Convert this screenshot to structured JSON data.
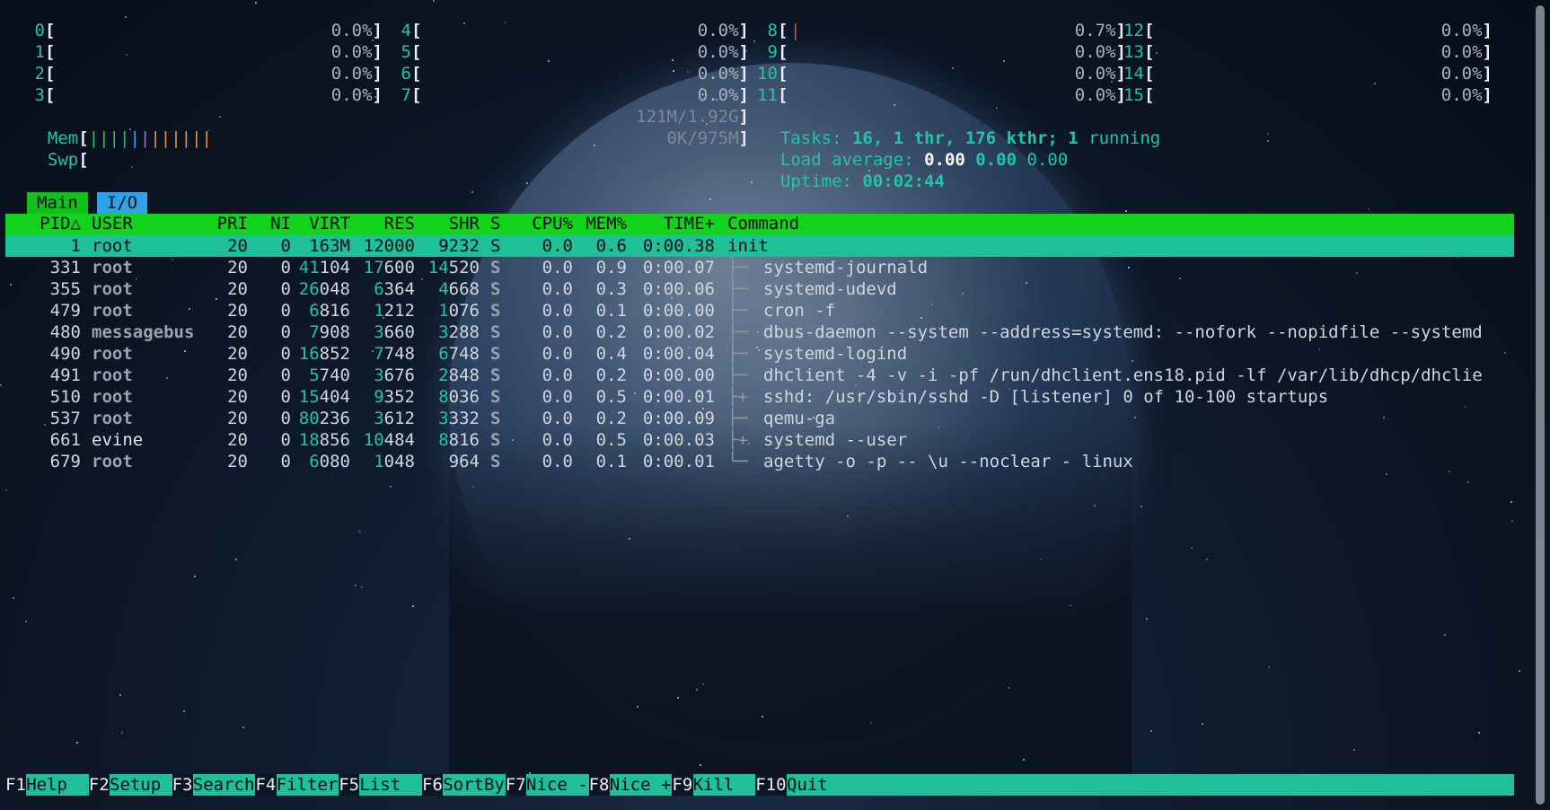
{
  "cpus": [
    {
      "id": "0",
      "value": "0.0%"
    },
    {
      "id": "1",
      "value": "0.0%"
    },
    {
      "id": "2",
      "value": "0.0%"
    },
    {
      "id": "3",
      "value": "0.0%"
    },
    {
      "id": "4",
      "value": "0.0%"
    },
    {
      "id": "5",
      "value": "0.0%"
    },
    {
      "id": "6",
      "value": "0.0%"
    },
    {
      "id": "7",
      "value": "0.0%"
    },
    {
      "id": "8",
      "value": "0.7%"
    },
    {
      "id": "9",
      "value": "0.0%"
    },
    {
      "id": "10",
      "value": "0.0%"
    },
    {
      "id": "11",
      "value": "0.0%"
    },
    {
      "id": "12",
      "value": "0.0%"
    },
    {
      "id": "13",
      "value": "0.0%"
    },
    {
      "id": "14",
      "value": "0.0%"
    },
    {
      "id": "15",
      "value": "0.0%"
    }
  ],
  "mem": {
    "label": "Mem",
    "value": "121M/1.92G"
  },
  "swp": {
    "label": "Swp",
    "value": "0K/975M"
  },
  "tasks": {
    "label": "Tasks:",
    "count": "16,",
    "thr": "1 thr,",
    "kthr": "176 kthr;",
    "running_count": "1",
    "running": "running"
  },
  "load": {
    "label": "Load average:",
    "l1": "0.00",
    "l5": "0.00",
    "l15": "0.00"
  },
  "uptime": {
    "label": "Uptime:",
    "value": "00:02:44"
  },
  "tabs": {
    "main": "Main",
    "io": "I/O"
  },
  "headers": {
    "pid": "PID",
    "sort": "△",
    "user": "USER",
    "pri": "PRI",
    "ni": "NI",
    "virt": "VIRT",
    "res": "RES",
    "shr": "SHR",
    "s": "S",
    "cpu": "CPU%",
    "mem": "MEM%",
    "time": "TIME+",
    "command": "Command"
  },
  "processes": [
    {
      "pid": "1",
      "user": "root",
      "pri": "20",
      "ni": "0",
      "virt": "163M",
      "res": "12000",
      "shr": "9232",
      "s": "S",
      "cpu": "0.0",
      "mem": "0.6",
      "time": "0:00.38",
      "tree": "",
      "command": "init"
    },
    {
      "pid": "331",
      "user": "root",
      "pri": "20",
      "ni": "0",
      "virt": "41104",
      "res": "17600",
      "shr": "14520",
      "s": "S",
      "cpu": "0.0",
      "mem": "0.9",
      "time": "0:00.07",
      "tree": "├─",
      "command": "systemd-journald"
    },
    {
      "pid": "355",
      "user": "root",
      "pri": "20",
      "ni": "0",
      "virt": "26048",
      "res": "6364",
      "shr": "4668",
      "s": "S",
      "cpu": "0.0",
      "mem": "0.3",
      "time": "0:00.06",
      "tree": "├─",
      "command": "systemd-udevd"
    },
    {
      "pid": "479",
      "user": "root",
      "pri": "20",
      "ni": "0",
      "virt": "6816",
      "res": "1212",
      "shr": "1076",
      "s": "S",
      "cpu": "0.0",
      "mem": "0.1",
      "time": "0:00.00",
      "tree": "├─",
      "command": "cron -f"
    },
    {
      "pid": "480",
      "user": "messagebus",
      "pri": "20",
      "ni": "0",
      "virt": "7908",
      "res": "3660",
      "shr": "3288",
      "s": "S",
      "cpu": "0.0",
      "mem": "0.2",
      "time": "0:00.02",
      "tree": "├─",
      "command": "dbus-daemon --system --address=systemd: --nofork --nopidfile --systemd"
    },
    {
      "pid": "490",
      "user": "root",
      "pri": "20",
      "ni": "0",
      "virt": "16852",
      "res": "7748",
      "shr": "6748",
      "s": "S",
      "cpu": "0.0",
      "mem": "0.4",
      "time": "0:00.04",
      "tree": "├─",
      "command": "systemd-logind"
    },
    {
      "pid": "491",
      "user": "root",
      "pri": "20",
      "ni": "0",
      "virt": "5740",
      "res": "3676",
      "shr": "2848",
      "s": "S",
      "cpu": "0.0",
      "mem": "0.2",
      "time": "0:00.00",
      "tree": "├─",
      "command": "dhclient -4 -v -i -pf /run/dhclient.ens18.pid -lf /var/lib/dhcp/dhclie"
    },
    {
      "pid": "510",
      "user": "root",
      "pri": "20",
      "ni": "0",
      "virt": "15404",
      "res": "9352",
      "shr": "8036",
      "s": "S",
      "cpu": "0.0",
      "mem": "0.5",
      "time": "0:00.01",
      "tree": "├+",
      "command": "sshd: /usr/sbin/sshd -D [listener] 0 of 10-100 startups"
    },
    {
      "pid": "537",
      "user": "root",
      "pri": "20",
      "ni": "0",
      "virt": "80236",
      "res": "3612",
      "shr": "3332",
      "s": "S",
      "cpu": "0.0",
      "mem": "0.2",
      "time": "0:00.09",
      "tree": "├─",
      "command": "qemu-ga"
    },
    {
      "pid": "661",
      "user": "evine",
      "pri": "20",
      "ni": "0",
      "virt": "18856",
      "res": "10484",
      "shr": "8816",
      "s": "S",
      "cpu": "0.0",
      "mem": "0.5",
      "time": "0:00.03",
      "tree": "├+",
      "command": "systemd --user"
    },
    {
      "pid": "679",
      "user": "root",
      "pri": "20",
      "ni": "0",
      "virt": "6080",
      "res": "1048",
      "shr": "964",
      "s": "S",
      "cpu": "0.0",
      "mem": "0.1",
      "time": "0:00.01",
      "tree": "└─",
      "command": "agetty -o -p -- \\u --noclear - linux"
    }
  ],
  "fkeys": [
    {
      "key": "F1",
      "label": "Help"
    },
    {
      "key": "F2",
      "label": "Setup"
    },
    {
      "key": "F3",
      "label": "Search"
    },
    {
      "key": "F4",
      "label": "Filter"
    },
    {
      "key": "F5",
      "label": "List"
    },
    {
      "key": "F6",
      "label": "SortBy"
    },
    {
      "key": "F7",
      "label": "Nice -"
    },
    {
      "key": "F8",
      "label": "Nice +"
    },
    {
      "key": "F9",
      "label": "Kill"
    },
    {
      "key": "F10",
      "label": "Quit"
    }
  ],
  "colors": {
    "header_green": "#12d21a",
    "selected_teal": "#1fbf99",
    "tab_io_blue": "#2ea3e6",
    "label_teal": "#22c5a5"
  }
}
